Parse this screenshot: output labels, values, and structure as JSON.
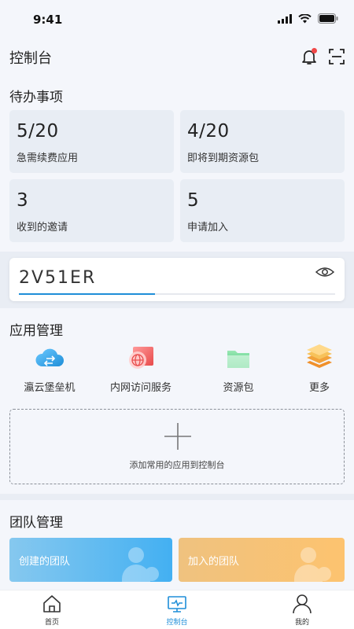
{
  "status_bar": {
    "time": "9:41"
  },
  "header": {
    "title": "控制台",
    "bell_icon": "bell-icon",
    "scan_icon": "scan-icon",
    "badge_color": "#f04848"
  },
  "todo": {
    "title": "待办事项",
    "cards": [
      {
        "value": "5/20",
        "label": "急需续费应用"
      },
      {
        "value": "4/20",
        "label": "即将到期资源包"
      },
      {
        "value": "3",
        "label": "收到的邀请"
      },
      {
        "value": "5",
        "label": "申请加入"
      }
    ]
  },
  "code": {
    "value": "2V51ER",
    "progress": 0.43,
    "eye_icon": "eye-icon",
    "accent": "#1e8ed8"
  },
  "apps": {
    "title": "应用管理",
    "items": [
      {
        "label": "瀛云堡垒机",
        "icon": "cloud-icon"
      },
      {
        "label": "内网访问服务",
        "icon": "globe-icon"
      },
      {
        "label": "资源包",
        "icon": "folder-icon"
      },
      {
        "label": "更多",
        "icon": "layers-icon"
      }
    ],
    "add_text": "添加常用的应用到控制台"
  },
  "team": {
    "title": "团队管理",
    "created": "创建的团队",
    "joined": "加入的团队"
  },
  "tabs": [
    {
      "label": "首页",
      "icon": "home-icon"
    },
    {
      "label": "控制台",
      "icon": "console-icon",
      "active": true
    },
    {
      "label": "我的",
      "icon": "user-icon"
    }
  ]
}
